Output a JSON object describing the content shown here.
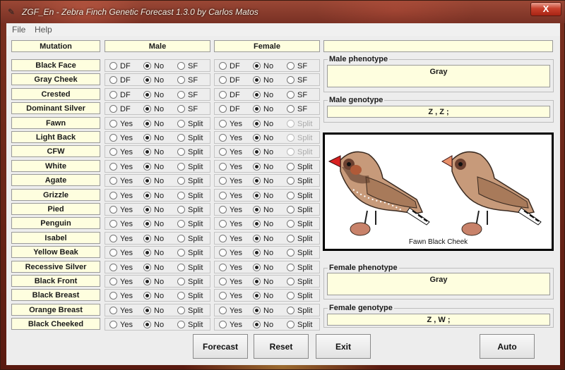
{
  "window": {
    "title": "ZGF_En - Zebra Finch Genetic Forecast 1.3.0 by Carlos Matos",
    "close_label": "X"
  },
  "menu": [
    "File",
    "Help"
  ],
  "headers": {
    "mutation": "Mutation",
    "male": "Male",
    "female": "Female"
  },
  "rows": [
    {
      "label": "Black Face",
      "options": [
        "DF",
        "No",
        "SF"
      ],
      "male": 1,
      "female": 1,
      "male_disabled": [],
      "female_disabled": []
    },
    {
      "label": "Gray Cheek",
      "options": [
        "DF",
        "No",
        "SF"
      ],
      "male": 1,
      "female": 1,
      "male_disabled": [],
      "female_disabled": []
    },
    {
      "label": "Crested",
      "options": [
        "DF",
        "No",
        "SF"
      ],
      "male": 1,
      "female": 1,
      "male_disabled": [],
      "female_disabled": []
    },
    {
      "label": "Dominant Silver",
      "options": [
        "DF",
        "No",
        "SF"
      ],
      "male": 1,
      "female": 1,
      "male_disabled": [],
      "female_disabled": []
    },
    {
      "label": "Fawn",
      "options": [
        "Yes",
        "No",
        "Split"
      ],
      "male": 1,
      "female": 1,
      "male_disabled": [],
      "female_disabled": [
        2
      ]
    },
    {
      "label": "Light Back",
      "options": [
        "Yes",
        "No",
        "Split"
      ],
      "male": 1,
      "female": 1,
      "male_disabled": [],
      "female_disabled": [
        2
      ]
    },
    {
      "label": "CFW",
      "options": [
        "Yes",
        "No",
        "Split"
      ],
      "male": 1,
      "female": 1,
      "male_disabled": [],
      "female_disabled": [
        2
      ]
    },
    {
      "label": "White",
      "options": [
        "Yes",
        "No",
        "Split"
      ],
      "male": 1,
      "female": 1,
      "male_disabled": [],
      "female_disabled": []
    },
    {
      "label": "Agate",
      "options": [
        "Yes",
        "No",
        "Split"
      ],
      "male": 1,
      "female": 1,
      "male_disabled": [],
      "female_disabled": []
    },
    {
      "label": "Grizzle",
      "options": [
        "Yes",
        "No",
        "Split"
      ],
      "male": 1,
      "female": 1,
      "male_disabled": [],
      "female_disabled": []
    },
    {
      "label": "Pied",
      "options": [
        "Yes",
        "No",
        "Split"
      ],
      "male": 1,
      "female": 1,
      "male_disabled": [],
      "female_disabled": []
    },
    {
      "label": "Penguin",
      "options": [
        "Yes",
        "No",
        "Split"
      ],
      "male": 1,
      "female": 1,
      "male_disabled": [],
      "female_disabled": []
    },
    {
      "label": "Isabel",
      "options": [
        "Yes",
        "No",
        "Split"
      ],
      "male": 1,
      "female": 1,
      "male_disabled": [],
      "female_disabled": []
    },
    {
      "label": "Yellow Beak",
      "options": [
        "Yes",
        "No",
        "Split"
      ],
      "male": 1,
      "female": 1,
      "male_disabled": [],
      "female_disabled": []
    },
    {
      "label": "Recessive Silver",
      "options": [
        "Yes",
        "No",
        "Split"
      ],
      "male": 1,
      "female": 1,
      "male_disabled": [],
      "female_disabled": []
    },
    {
      "label": "Black Front",
      "options": [
        "Yes",
        "No",
        "Split"
      ],
      "male": 1,
      "female": 1,
      "male_disabled": [],
      "female_disabled": []
    },
    {
      "label": "Black Breast",
      "options": [
        "Yes",
        "No",
        "Split"
      ],
      "male": 1,
      "female": 1,
      "male_disabled": [],
      "female_disabled": []
    },
    {
      "label": "Orange Breast",
      "options": [
        "Yes",
        "No",
        "Split"
      ],
      "male": 1,
      "female": 1,
      "male_disabled": [],
      "female_disabled": []
    },
    {
      "label": "Black Cheeked",
      "options": [
        "Yes",
        "No",
        "Split"
      ],
      "male": 1,
      "female": 1,
      "male_disabled": [],
      "female_disabled": []
    }
  ],
  "right": {
    "top_field": "",
    "male_phenotype_label": "Male phenotype",
    "male_phenotype": "Gray",
    "male_genotype_label": "Male genotype",
    "male_genotype": "Z , Z ;",
    "image_caption": "Fawn Black Cheek",
    "female_phenotype_label": "Female phenotype",
    "female_phenotype": "Gray",
    "female_genotype_label": "Female genotype",
    "female_genotype": "Z , W ;"
  },
  "buttons": {
    "forecast": "Forecast",
    "reset": "Reset",
    "exit": "Exit",
    "auto": "Auto"
  },
  "colors": {
    "field_bg": "#fefedf",
    "panel_bg": "#ededed",
    "close_red": "#c8402c"
  }
}
